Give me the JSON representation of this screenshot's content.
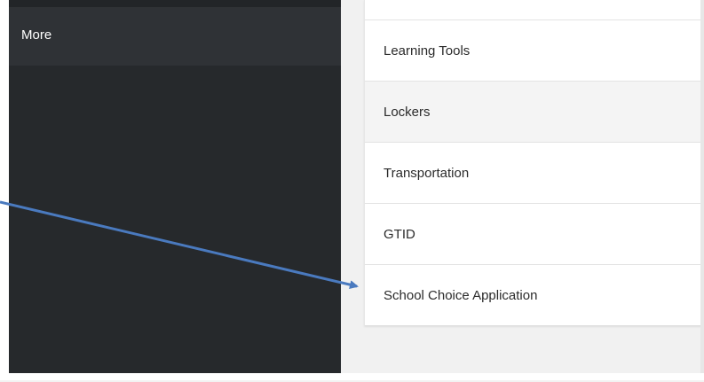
{
  "sidebar": {
    "items": [
      {
        "label": "More"
      }
    ]
  },
  "menu": {
    "items": [
      {
        "label": "Learning Tools",
        "state": "normal"
      },
      {
        "label": "Lockers",
        "state": "hover"
      },
      {
        "label": "Transportation",
        "state": "normal"
      },
      {
        "label": "GTID",
        "state": "normal"
      },
      {
        "label": "School Choice Application",
        "state": "normal"
      }
    ]
  },
  "annotation": {
    "type": "arrow",
    "color": "#4a7abf",
    "target": "School Choice Application"
  },
  "colors": {
    "sidebar_bg": "#26292c",
    "sidebar_active_bg": "#2f3236",
    "content_bg": "#f1f1f1",
    "list_bg": "#ffffff",
    "hover_bg": "#f4f4f4"
  }
}
